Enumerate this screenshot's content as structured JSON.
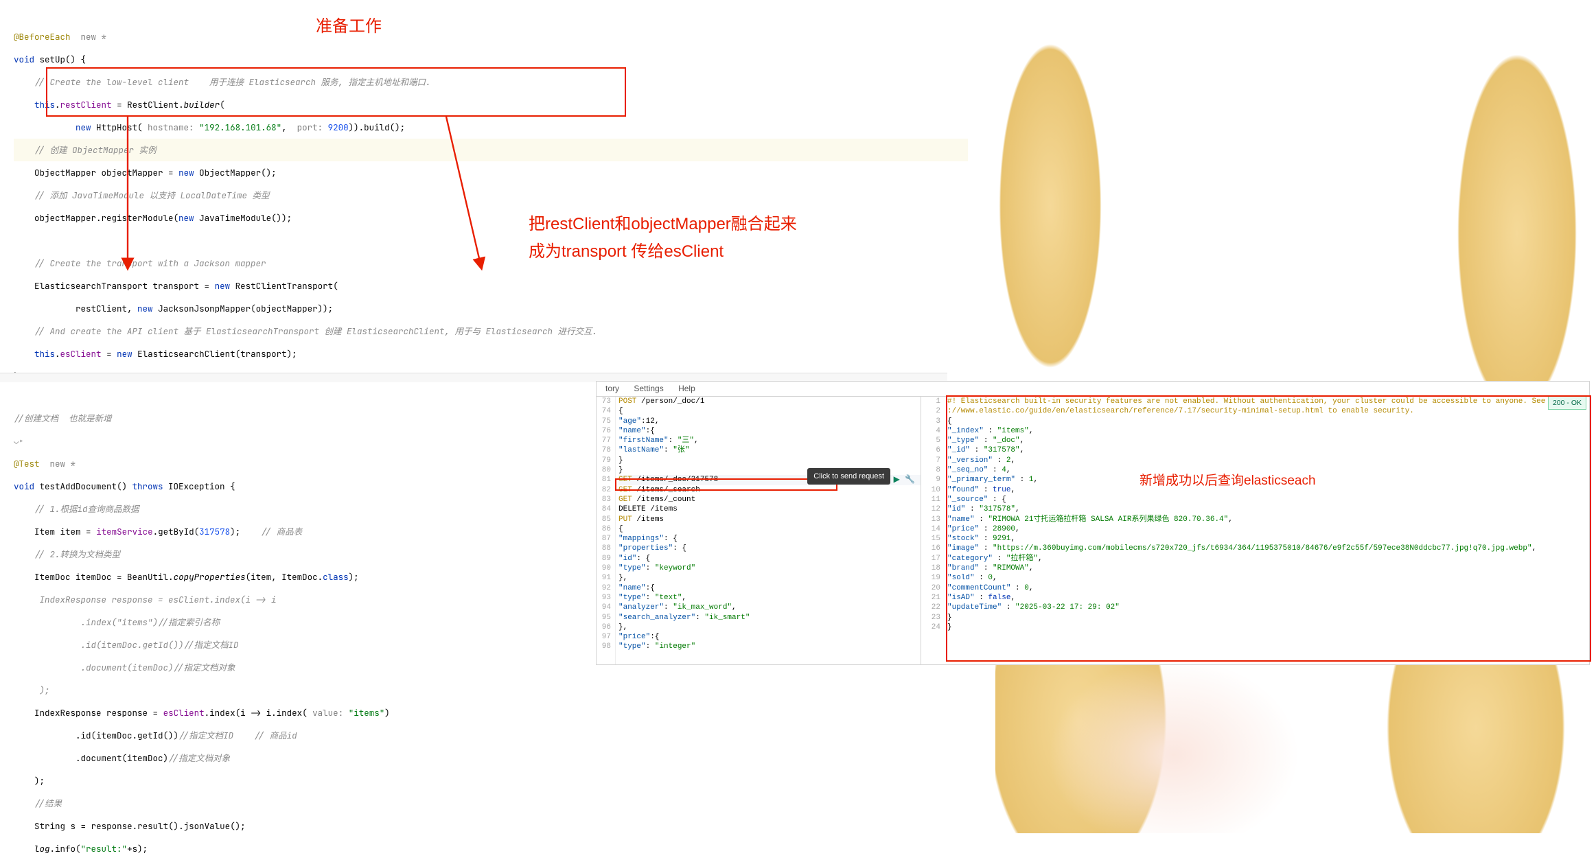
{
  "annotations": {
    "prep": "准备工作",
    "merge_line1": "把restClient和objectMapper融合起来",
    "merge_line2": "成为transport 传给esClient",
    "result_label": "新增成功以后查询elasticseach"
  },
  "code1": {
    "ann_before": "@BeforeEach",
    "ann_new": "new *",
    "l2a": "void",
    "l2b": " setUp() {",
    "l3a": "// Create the low-level client    用于连接 Elasticsearch 服务, 指定主机地址和端口.",
    "l4a": "this",
    "l4b": ".",
    "l4c": "restClient",
    "l4d": " = RestClient.",
    "l4e": "builder",
    "l4f": "(",
    "l5a": "new",
    "l5b": " HttpHost( ",
    "l5c": "hostname:",
    "l5d": " ",
    "l5e": "\"192.168.101.68\"",
    "l5f": ",  ",
    "l5g": "port:",
    "l5h": " ",
    "l5i": "9200",
    "l5j": ")).build();",
    "l6": "// 创建 ObjectMapper 实例",
    "l7a": "ObjectMapper ",
    "l7b": "objectMapper",
    "l7c": " = ",
    "l7d": "new",
    "l7e": " ObjectMapper();",
    "l8": "// 添加 JavaTimeModule 以支持 LocalDateTime 类型",
    "l9a": "objectMapper",
    "l9b": ".registerModule(",
    "l9c": "new",
    "l9d": " JavaTimeModule());",
    "l10": "// Create the transport with a Jackson mapper",
    "l11a": "ElasticsearchTransport ",
    "l11b": "transport",
    "l11c": " = ",
    "l11d": "new",
    "l11e": " RestClientTransport(",
    "l12a": "restClient",
    "l12b": ", ",
    "l12c": "new",
    "l12d": " JacksonJsonpMapper(",
    "l12e": "objectMapper",
    "l12f": "));",
    "l13": "// And create the API client 基于 ElasticsearchTransport 创建 ElasticsearchClient, 用于与 Elasticsearch 进行交互.",
    "l14a": "this",
    "l14b": ".",
    "l14c": "esClient",
    "l14d": " = ",
    "l14e": "new",
    "l14f": " ElasticsearchClient(",
    "l14g": "transport",
    "l14h": ");",
    "close": "}"
  },
  "code2": {
    "c1": "//创建文档  也就是新增",
    "ann_test": "@Test",
    "ann_new": "new *",
    "l2a": "void",
    "l2b": " testAddDocument() ",
    "l2c": "throws",
    "l2d": " IOException {",
    "l3": "// 1.根据id查询商品数据",
    "l4a": "Item ",
    "l4b": "item",
    "l4c": " = ",
    "l4d": "itemService",
    "l4e": ".getById(",
    "l4f": "317578",
    "l4g": ");    ",
    "l4h": "// 商品表",
    "l5": "// 2.转换为文档类型",
    "l6a": "ItemDoc ",
    "l6b": "itemDoc",
    "l6c": " = BeanUtil.",
    "l6d": "copyProperties",
    "l6e": "(",
    "l6f": "item",
    "l6g": ", ItemDoc.",
    "l6h": "class",
    "l6i": ");",
    "l7a": " IndexResponse response = esClient.index(i -> i",
    "l8a": "         .index(\"items\")//指定索引名称",
    "l9a": "         .id(itemDoc.getId())//指定文档ID",
    "l10a": "         .document(itemDoc)//指定文档对象",
    "l11a": " );",
    "l12a": "IndexResponse ",
    "l12b": "response",
    "l12c": " = ",
    "l12d": "esClient",
    "l12e": ".index(",
    "l12f": "i",
    "l12g": " -> ",
    "l12h": "i",
    "l12i": ".index( ",
    "l12j": "value:",
    "l12k": " ",
    "l12l": "\"items\"",
    "l12m": ")",
    "l13a": "        .id(",
    "l13b": "itemDoc",
    "l13c": ".getId())",
    "l13d": "//指定文档ID    // 商品id",
    "l14a": "        .document(",
    "l14b": "itemDoc",
    "l14c": ")",
    "l14d": "//指定文档对象",
    "l15": ");",
    "l16": "//结果",
    "l17a": "String ",
    "l17b": "s",
    "l17c": " = ",
    "l17d": "response",
    "l17e": ".result().jsonValue();",
    "l18a": "log",
    "l18b": ".info(",
    "l18c": "\"result:\"",
    "l18d": "+",
    "l18e": "s",
    "l18f": ");"
  },
  "kibana": {
    "menu": {
      "history": "tory",
      "settings": "Settings",
      "help": "Help"
    },
    "tooltip": "Click to send request",
    "status": "200 - OK",
    "req_start_line": 73,
    "req": [
      {
        "m": "POST",
        "p": " /person/_doc/1"
      },
      {
        "t": "{"
      },
      {
        "t": "  \"age\":12,"
      },
      {
        "t": "  \"name\":{"
      },
      {
        "t": "    \"firstName\":\"三\","
      },
      {
        "t": "    \"lastName\":\"张\""
      },
      {
        "t": "  }"
      },
      {
        "t": "}"
      },
      {
        "m": "GET",
        "p": " /items/_doc/317578",
        "active": true,
        "run": true
      },
      {
        "m": "GET",
        "p": " /items/_search"
      },
      {
        "m": "GET",
        "p": " /items/_count"
      },
      {
        "m": "DELETE",
        "p": " /items"
      },
      {
        "m": "PUT",
        "p": " /items"
      },
      {
        "t": "{"
      },
      {
        "t": "  \"mappings\": {"
      },
      {
        "t": "    \"properties\": {"
      },
      {
        "t": "      \"id\": {"
      },
      {
        "t": "        \"type\": \"keyword\""
      },
      {
        "t": "      },"
      },
      {
        "t": "      \"name\":{"
      },
      {
        "t": "        \"type\": \"text\","
      },
      {
        "t": "        \"analyzer\": \"ik_max_word\","
      },
      {
        "t": "        \"search_analyzer\": \"ik_smart\""
      },
      {
        "t": "      },"
      },
      {
        "t": "      \"price\":{"
      },
      {
        "t": "        \"type\": \"integer\""
      }
    ],
    "resp": [
      "#! Elasticsearch built-in security features are not enabled. Without authentication, your cluster could be accessible to anyone. See htt",
      "://www.elastic.co/guide/en/elasticsearch/reference/7.17/security-minimal-setup.html to enable security.",
      "{",
      "  \"_index\" : \"items\",",
      "  \"_type\" : \"_doc\",",
      "  \"_id\" : \"317578\",",
      "  \"_version\" : 2,",
      "  \"_seq_no\" : 4,",
      "  \"_primary_term\" : 1,",
      "  \"found\" : true,",
      "  \"_source\" : {",
      "    \"id\" : \"317578\",",
      "    \"name\" : \"RIMOWA 21寸托运箱拉杆箱 SALSA AIR系列果绿色 820.70.36.4\",",
      "    \"price\" : 28900,",
      "    \"stock\" : 9291,",
      "    \"image\" : \"https://m.360buyimg.com/mobilecms/s720x720_jfs/t6934/364/1195375010/84676/e9f2c55f/597ece38N0ddcbc77.jpg!q70.jpg.webp\",",
      "    \"category\" : \"拉杆箱\",",
      "    \"brand\" : \"RIMOWA\",",
      "    \"sold\" : 0,",
      "    \"commentCount\" : 0,",
      "    \"isAD\" : false,",
      "    \"updateTime\" : \"2025-03-22 17:29:02\"",
      "  }",
      "}"
    ]
  }
}
